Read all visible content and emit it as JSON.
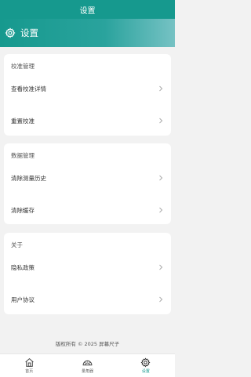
{
  "status_bar": {
    "title": "设置"
  },
  "header": {
    "title": "设置",
    "icon": "gear-icon"
  },
  "sections": [
    {
      "title": "校准管理",
      "items": [
        {
          "label": "查看校准详情"
        },
        {
          "label": "重置校准"
        }
      ]
    },
    {
      "title": "数据管理",
      "items": [
        {
          "label": "清除测量历史"
        },
        {
          "label": "清除缓存"
        }
      ]
    },
    {
      "title": "关于",
      "items": [
        {
          "label": "隐私政策"
        },
        {
          "label": "用户协议"
        }
      ]
    }
  ],
  "footer": {
    "copyright": "版权所有 © 2025 屏幕尺子"
  },
  "tabbar": {
    "tabs": [
      {
        "label": "首页",
        "icon": "home-icon"
      },
      {
        "label": "量角器",
        "icon": "protractor-icon"
      },
      {
        "label": "设置",
        "icon": "gear-icon",
        "active": true
      }
    ]
  },
  "colors": {
    "accent": "#16998e",
    "background": "#f2f2f2"
  }
}
